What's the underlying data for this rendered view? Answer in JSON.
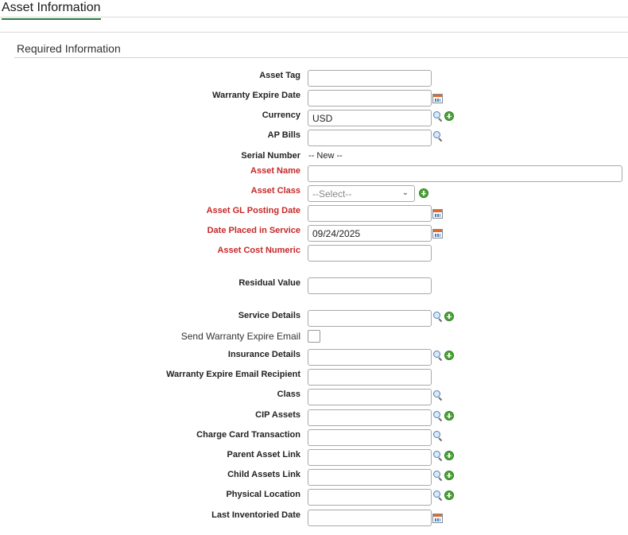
{
  "page": {
    "title": "Asset Information"
  },
  "section": {
    "title": "Required Information"
  },
  "fields": {
    "asset_tag": {
      "label": "Asset Tag",
      "value": ""
    },
    "warranty_expire_date": {
      "label": "Warranty Expire Date",
      "value": ""
    },
    "currency": {
      "label": "Currency",
      "value": "USD"
    },
    "ap_bills": {
      "label": "AP Bills",
      "value": ""
    },
    "serial_number": {
      "label": "Serial Number",
      "value": "-- New --"
    },
    "asset_name": {
      "label": "Asset Name",
      "value": "",
      "required": true
    },
    "asset_class": {
      "label": "Asset Class",
      "selected": "--Select--",
      "required": true
    },
    "asset_gl_posting_date": {
      "label": "Asset GL Posting Date",
      "value": "",
      "required": true
    },
    "date_placed_in_service": {
      "label": "Date Placed in Service",
      "value": "09/24/2025",
      "required": true
    },
    "asset_cost_numeric": {
      "label": "Asset Cost Numeric",
      "value": "",
      "required": true
    },
    "residual_value": {
      "label": "Residual Value",
      "value": ""
    },
    "service_details": {
      "label": "Service Details",
      "value": ""
    },
    "send_warranty_expire_email": {
      "label": "Send Warranty Expire Email",
      "checked": false
    },
    "insurance_details": {
      "label": "Insurance Details",
      "value": ""
    },
    "warranty_expire_email_recipient": {
      "label": "Warranty Expire Email Recipient",
      "value": ""
    },
    "class": {
      "label": "Class",
      "value": ""
    },
    "cip_assets": {
      "label": "CIP Assets",
      "value": ""
    },
    "charge_card_transaction": {
      "label": "Charge Card Transaction",
      "value": ""
    },
    "parent_asset_link": {
      "label": "Parent Asset Link",
      "value": ""
    },
    "child_assets_link": {
      "label": "Child Assets Link",
      "value": ""
    },
    "physical_location": {
      "label": "Physical Location",
      "value": ""
    },
    "last_inventoried_date": {
      "label": "Last Inventoried Date",
      "value": ""
    }
  },
  "colors": {
    "accent": "#2c7a3f",
    "required": "#c62828",
    "add": "#4fa53a"
  }
}
